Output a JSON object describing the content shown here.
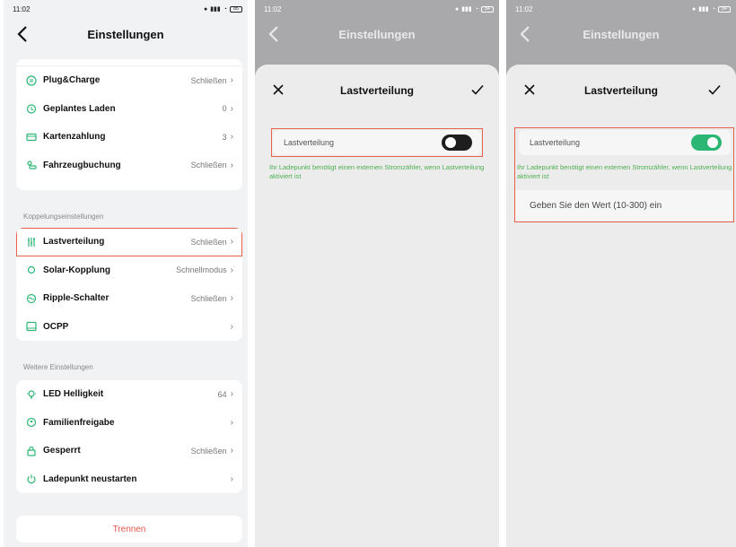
{
  "status_bar": {
    "time": "11:02",
    "network": "4G⁺ ",
    "battery_left": "85",
    "battery_right": "84"
  },
  "screen1": {
    "title": "Einstellungen",
    "top_items": [
      {
        "label": "Plug&Charge",
        "value": "Schließen",
        "icon": "plug-icon"
      },
      {
        "label": "Geplantes Laden",
        "value": "0",
        "icon": "clock-icon"
      },
      {
        "label": "Kartenzahlung",
        "value": "3",
        "icon": "card-icon"
      },
      {
        "label": "Fahrzeugbuchung",
        "value": "Schließen",
        "icon": "car-booking-icon"
      }
    ],
    "coupling_section": "Koppelungseinstellungen",
    "coupling_items": [
      {
        "label": "Lastverteilung",
        "value": "Schließen",
        "icon": "load-balance-icon"
      },
      {
        "label": "Solar-Kopplung",
        "value": "Schnellmodus",
        "icon": "sun-icon"
      },
      {
        "label": "Ripple-Schalter",
        "value": "Schließen",
        "icon": "ripple-icon"
      },
      {
        "label": "OCPP",
        "value": "",
        "icon": "monitor-icon"
      }
    ],
    "further_section": "Weitere Einstellungen",
    "further_items": [
      {
        "label": "LED Helligkeit",
        "value": "64",
        "icon": "bulb-icon"
      },
      {
        "label": "Familienfreigabe",
        "value": "",
        "icon": "family-icon"
      },
      {
        "label": "Gesperrt",
        "value": "Schließen",
        "icon": "lock-icon"
      },
      {
        "label": "Ladepunkt neustarten",
        "value": "",
        "icon": "power-icon"
      }
    ],
    "disconnect_button": "Trennen"
  },
  "screen2": {
    "nav_title": "Einstellungen",
    "sheet_title": "Lastverteilung",
    "toggle_label": "Lastverteilung",
    "toggle_on": false,
    "note": "Ihr Ladepunkt benötigt einen externen Stromzähler, wenn Lastverteilung aktiviert ist"
  },
  "screen3": {
    "nav_title": "Einstellungen",
    "sheet_title": "Lastverteilung",
    "toggle_label": "Lastverteilung",
    "toggle_on": true,
    "note": "Ihr Ladepunkt benötigt einen externen Stromzähler, wenn Lastverteilung aktiviert ist",
    "input_placeholder": "Geben Sie den Wert (10-300) ein"
  },
  "colors": {
    "accent_green": "#2bb673",
    "highlight_red": "#e8604c",
    "danger_text": "#e6564c",
    "note_green": "#4caf50"
  }
}
